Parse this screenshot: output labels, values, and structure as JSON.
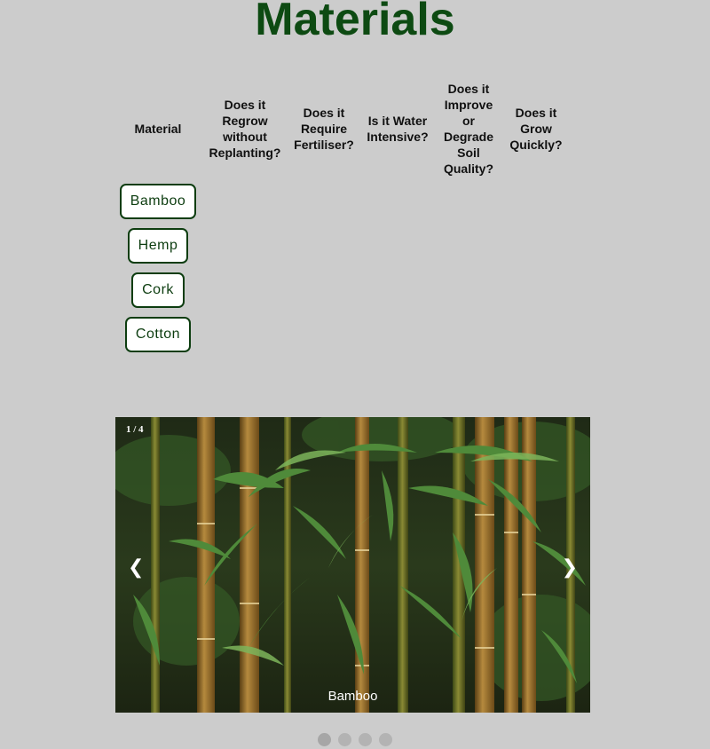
{
  "page": {
    "title": "Materials"
  },
  "table": {
    "headers": [
      "Material",
      "Does it Regrow without Replanting?",
      "Does it Require Fertiliser?",
      "Is it Water Intensive?",
      "Does it Improve or Degrade Soil Quality?",
      "Does it Grow Quickly?"
    ],
    "materials": [
      "Bamboo",
      "Hemp",
      "Cork",
      "Cotton"
    ]
  },
  "slideshow": {
    "counter": "1 / 4",
    "prev_icon": "❮",
    "next_icon": "❯",
    "caption": "Bamboo",
    "slide_count": 4,
    "active_index": 0
  },
  "colors": {
    "background": "#cccccc",
    "title": "#0d4a12",
    "button_border": "#0d3d10",
    "dot": "#b3b3b3"
  }
}
